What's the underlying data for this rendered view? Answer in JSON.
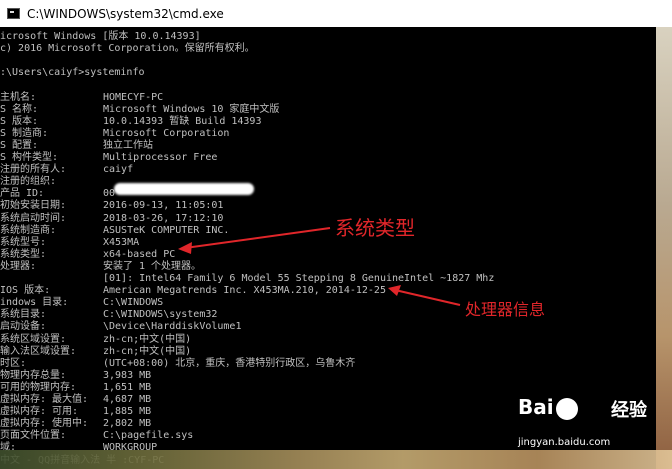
{
  "window": {
    "title": "C:\\WINDOWS\\system32\\cmd.exe"
  },
  "console": {
    "header": [
      "icrosoft Windows [版本 10.0.14393]",
      "c) 2016 Microsoft Corporation。保留所有权利。",
      "",
      ":\\Users\\caiyf>systeminfo"
    ],
    "rows": [
      {
        "label": "主机名:",
        "value": "HOMECYF-PC"
      },
      {
        "label": "S 名称:",
        "value": "Microsoft Windows 10 家庭中文版"
      },
      {
        "label": "S 版本:",
        "value": "10.0.14393 暂缺 Build 14393"
      },
      {
        "label": "S 制造商:",
        "value": "Microsoft Corporation"
      },
      {
        "label": "S 配置:",
        "value": "独立工作站"
      },
      {
        "label": "S 构件类型:",
        "value": "Multiprocessor Free"
      },
      {
        "label": "注册的所有人:",
        "value": "caiyf"
      },
      {
        "label": "注册的组织:",
        "value": ""
      },
      {
        "label": "产品 ID:",
        "value": "00"
      },
      {
        "label": "初始安装日期:",
        "value": "2016-09-13, 11:05:01"
      },
      {
        "label": "系统启动时间:",
        "value": "2018-03-26, 17:12:10"
      },
      {
        "label": "系统制造商:",
        "value": "ASUSTeK COMPUTER INC."
      },
      {
        "label": "系统型号:",
        "value": "X453MA"
      },
      {
        "label": "系统类型:",
        "value": "x64-based PC"
      },
      {
        "label": "处理器:",
        "value": "安装了 1 个处理器。"
      },
      {
        "label": "",
        "value": "[01]: Intel64 Family 6 Model 55 Stepping 8 GenuineIntel ~1827 Mhz"
      },
      {
        "label": "IOS 版本:",
        "value": "American Megatrends Inc. X453MA.210, 2014-12-25"
      },
      {
        "label": "indows 目录:",
        "value": "C:\\WINDOWS"
      },
      {
        "label": "系统目录:",
        "value": "C:\\WINDOWS\\system32"
      },
      {
        "label": "启动设备:",
        "value": "\\Device\\HarddiskVolume1"
      },
      {
        "label": "系统区域设置:",
        "value": "zh-cn;中文(中国)"
      },
      {
        "label": "输入法区域设置:",
        "value": "zh-cn;中文(中国)"
      },
      {
        "label": "时区:",
        "value": "(UTC+08:00) 北京，重庆，香港特别行政区，乌鲁木齐"
      },
      {
        "label": "物理内存总量:",
        "value": "3,983 MB"
      },
      {
        "label": "可用的物理内存:",
        "value": "1,651 MB"
      },
      {
        "label": "虚拟内存: 最大值:",
        "value": "4,687 MB"
      },
      {
        "label": "虚拟内存: 可用:",
        "value": "1,885 MB"
      },
      {
        "label": "虚拟内存: 使用中:",
        "value": "2,802 MB"
      },
      {
        "label": "页面文件位置:",
        "value": "C:\\pagefile.sys"
      },
      {
        "label": "域:",
        "value": "WORKGROUP"
      }
    ],
    "footer": "中文 - QQ拼音输入法 半 :CYF-PC"
  },
  "annotations": {
    "system_type": "系统类型",
    "processor_info": "处理器信息"
  },
  "watermark": {
    "logo": "Bai",
    "logo_suffix": "经验",
    "url": "jingyan.baidu.com"
  },
  "colors": {
    "console_bg": "#000000",
    "console_text": "#c0c0c0",
    "annotation": "#e0262a"
  }
}
